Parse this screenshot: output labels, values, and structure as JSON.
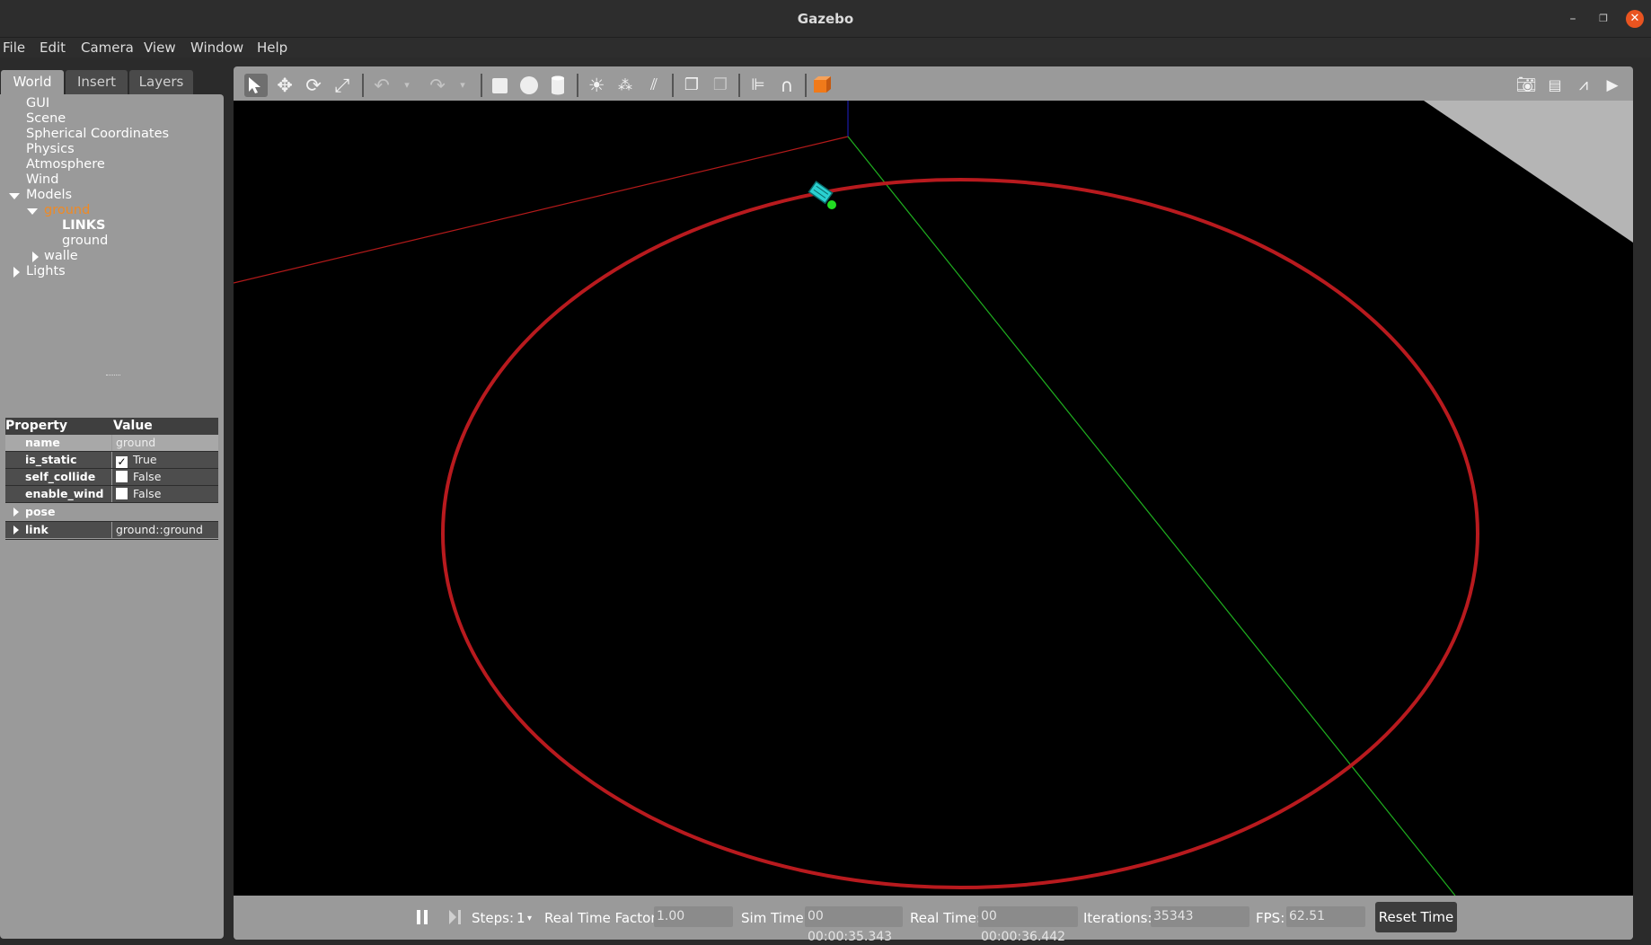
{
  "window": {
    "title": "Gazebo"
  },
  "menu": {
    "file": "File",
    "edit": "Edit",
    "camera": "Camera",
    "view": "View",
    "window": "Window",
    "help": "Help"
  },
  "tabs": {
    "world": "World",
    "insert": "Insert",
    "layers": "Layers"
  },
  "tree": {
    "gui": "GUI",
    "scene": "Scene",
    "spherical": "Spherical Coordinates",
    "physics": "Physics",
    "atmosphere": "Atmosphere",
    "wind": "Wind",
    "models": "Models",
    "ground": "ground",
    "links": "LINKS",
    "ground_link": "ground",
    "walle": "walle",
    "lights": "Lights"
  },
  "properties": {
    "header_property": "Property",
    "header_value": "Value",
    "name_key": "name",
    "name_val": "ground",
    "is_static_key": "is_static",
    "is_static_val": "True",
    "is_static_checked": true,
    "self_collide_key": "self_collide",
    "self_collide_val": "False",
    "self_collide_checked": false,
    "enable_wind_key": "enable_wind",
    "enable_wind_val": "False",
    "enable_wind_checked": false,
    "pose_key": "pose",
    "link_key": "link",
    "link_val": "ground::ground"
  },
  "toolbar": {
    "icons": [
      "select-icon",
      "translate-icon",
      "rotate-icon",
      "scale-icon",
      "undo-icon",
      "undo-dropdown-icon",
      "redo-icon",
      "redo-dropdown-icon",
      "box-icon",
      "sphere-icon",
      "cylinder-icon",
      "point-light-icon",
      "spot-light-icon",
      "directional-light-icon",
      "copy-icon",
      "paste-icon",
      "align-icon",
      "snap-icon",
      "view-angle-icon",
      "screenshot-icon",
      "log-icon",
      "plot-icon",
      "record-video-icon"
    ]
  },
  "bottom": {
    "steps_label": "Steps:",
    "steps_value": "1",
    "rtf_label": "Real Time Factor:",
    "rtf_value": "1.00",
    "sim_label": "Sim Time:",
    "sim_value": "00 00:00:35.343",
    "real_label": "Real Time:",
    "real_value": "00 00:00:36.442",
    "iter_label": "Iterations:",
    "iter_value": "35343",
    "fps_label": "FPS:",
    "fps_value": "62.51",
    "reset_label": "Reset Time"
  },
  "colors": {
    "selected": "#f08a24",
    "x_axis": "#b31a1a",
    "y_axis": "#1fae1f",
    "z_axis": "#1a1aa8",
    "track": "#b81a1e",
    "robot": "#2ad0d0",
    "close": "#e95420"
  }
}
